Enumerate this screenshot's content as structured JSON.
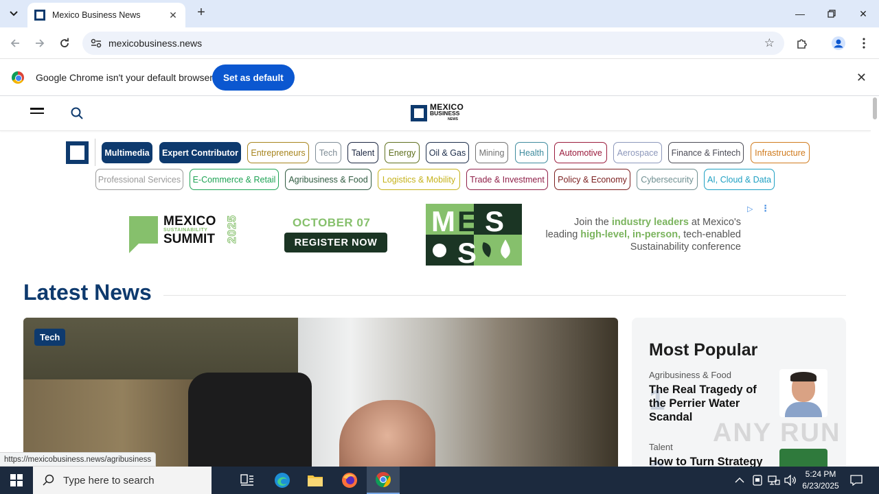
{
  "browser": {
    "tab_title": "Mexico Business News",
    "url": "mexicobusiness.news",
    "infobar_text": "Google Chrome isn't your default browser",
    "set_default_label": "Set as default",
    "status_url": "https://mexicobusiness.news/agribusiness"
  },
  "site": {
    "logo": {
      "line1": "MEXICO",
      "line2": "BUSINESS",
      "line3": "NEWS"
    },
    "categories_row1": [
      "Multimedia",
      "Expert Contributor",
      "Entrepreneurs",
      "Tech",
      "Talent",
      "Energy",
      "Oil & Gas",
      "Mining",
      "Health",
      "Automotive",
      "Aerospace",
      "Finance & Fintech",
      "Infrastructure"
    ],
    "categories_row2": [
      "Professional Services",
      "E-Commerce & Retail",
      "Agribusiness & Food",
      "Logistics & Mobility",
      "Trade & Investment",
      "Policy & Economy",
      "Cybersecurity",
      "AI, Cloud & Data"
    ],
    "category_colors_row1": [
      "#0e3a6e",
      "#0e3a6e",
      "#a6831b",
      "#7e8c96",
      "#1a2540",
      "#5e6f1d",
      "#1b2c49",
      "#717171",
      "#3d8a9d",
      "#9a1a3b",
      "#8c97bb",
      "#4a4a55",
      "#d07a1c"
    ],
    "category_colors_row2": [
      "#9a9a9a",
      "#1ea354",
      "#2e5a3f",
      "#c5b21a",
      "#8f1f48",
      "#7a1d1d",
      "#6f8f91",
      "#1d9fc2"
    ]
  },
  "ad": {
    "event_line1": "MEXICO",
    "event_line2": "SUSTAINABILITY",
    "event_line3": "SUMMIT",
    "event_year": "2025",
    "date": "OCTOBER 07",
    "cta": "REGISTER NOW",
    "copy_1": "Join the ",
    "copy_hl1": "industry leaders",
    "copy_2": " at Mexico's leading ",
    "copy_hl2": "high-level, in-person,",
    "copy_3": " tech-enabled Sustainability conference",
    "accent_color": "#86c06c"
  },
  "main": {
    "section_title": "Latest News",
    "hero_tag": "Tech"
  },
  "popular": {
    "title": "Most Popular",
    "items": [
      {
        "category": "Agribusiness & Food",
        "headline": "The Real Tragedy of the Perrier Water Scandal",
        "rank": "1"
      },
      {
        "category": "Talent",
        "headline": "How to Turn Strategy",
        "rank": "2"
      }
    ]
  },
  "watermark": "ANY RUN",
  "taskbar": {
    "search_placeholder": "Type here to search",
    "time": "5:24 PM",
    "date": "6/23/2025"
  }
}
